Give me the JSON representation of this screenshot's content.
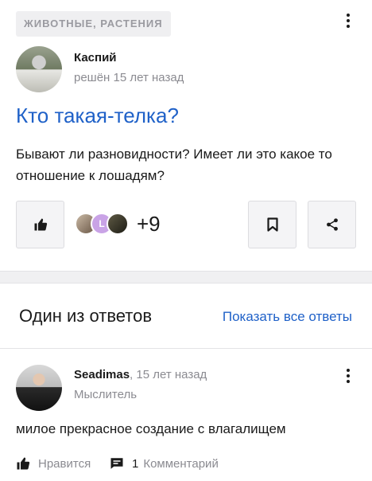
{
  "question": {
    "category": "ЖИВОТНЫЕ, РАСТЕНИЯ",
    "author": "Каспий",
    "time": "решён 15 лет назад",
    "title": "Кто такая-телка?",
    "body": "Бывают ли разновидности? Имеет ли это какое то отношение к лошадям?",
    "likers_letter": "L",
    "likers_extra": "+9",
    "icons": {
      "like": "thumbs-up-icon",
      "bookmark": "bookmark-icon",
      "share": "share-icon",
      "menu": "more-vertical-icon"
    }
  },
  "answers": {
    "heading": "Один из ответов",
    "show_all": "Показать все ответы",
    "answer": {
      "author": "Seadimas",
      "time": ", 15 лет назад",
      "rank": "Мыслитель",
      "text": "милое прекрасное создание с влагалищем",
      "like_label": "Нравится",
      "comments_count": "1",
      "comments_label": "Комментарий"
    }
  },
  "colors": {
    "link": "#1f61c8",
    "muted": "#8b8b91",
    "category_bg": "#efeff1"
  }
}
